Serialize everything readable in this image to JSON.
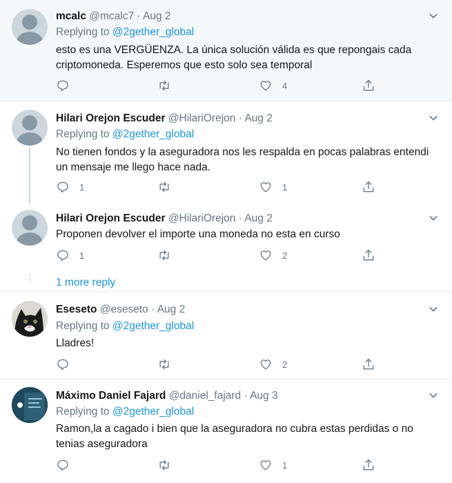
{
  "tweets": [
    {
      "name": "mcalc",
      "handle": "@mcalc7",
      "date": "· Aug 2",
      "replying_prefix": "Replying to",
      "replying_to": "@2gether_global",
      "text": "esto es una VERGÜENZA. La única solución válida es que repongais cada criptomoneda. Esperemos que esto solo sea temporal",
      "reply_count": "",
      "retweet_count": "",
      "like_count": "4"
    },
    {
      "name": "Hilari Orejon Escuder",
      "handle": "@HilariOrejon",
      "date": "· Aug 2",
      "replying_prefix": "Replying to",
      "replying_to": "@2gether_global",
      "text": "No tienen fondos y la aseguradora nos les respalda en pocas palabras entendi un mensaje me llego hace nada.",
      "reply_count": "1",
      "retweet_count": "",
      "like_count": "1"
    },
    {
      "name": "Hilari Orejon Escuder",
      "handle": "@HilariOrejon",
      "date": "· Aug 2",
      "text": "Proponen devolver el importe una moneda no esta en curso",
      "reply_count": "1",
      "retweet_count": "",
      "like_count": "2"
    },
    {
      "name": "Eseseto",
      "handle": "@eseseto",
      "date": "· Aug 2",
      "replying_prefix": "Replying to",
      "replying_to": "@2gether_global",
      "text": "Lladres!",
      "reply_count": "",
      "retweet_count": "",
      "like_count": "2"
    },
    {
      "name": "Máximo Daniel Fajard",
      "handle": "@daniel_fajard",
      "date": "· Aug 3",
      "replying_prefix": "Replying to",
      "replying_to": "@2gether_global",
      "text": "Ramon,la a cagado i bien que la aseguradora no cubra estas perdidas o no tenias aseguradora",
      "reply_count": "",
      "retweet_count": "",
      "like_count": "1"
    }
  ],
  "more_reply_label": "1 more reply",
  "icons": {
    "reply": "reply-icon",
    "retweet": "retweet-icon",
    "like": "heart-icon",
    "share": "share-icon",
    "menu": "chevron-down-icon"
  },
  "colors": {
    "link": "#1b95e0",
    "muted": "#657786",
    "highlight_bg": "#f5f8fa"
  }
}
